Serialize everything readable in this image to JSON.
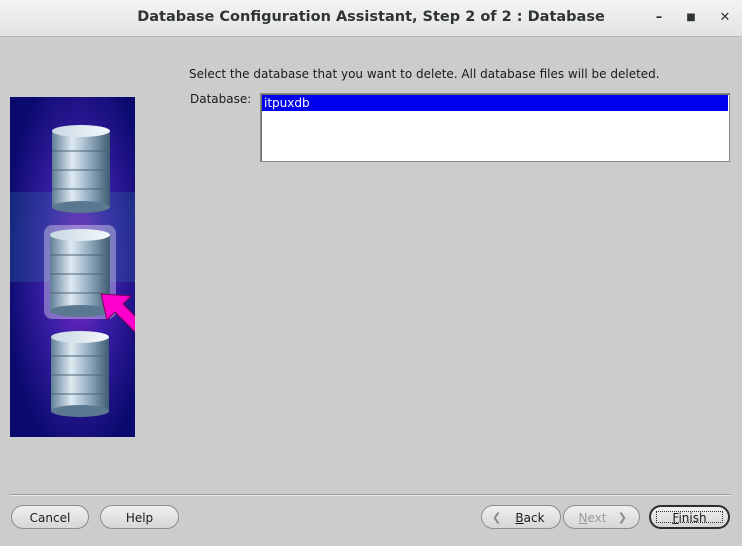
{
  "window": {
    "title": "Database Configuration Assistant, Step 2 of 2 : Database",
    "controls": {
      "minimize": "–",
      "maximize": "■",
      "close": "✕"
    }
  },
  "main": {
    "instruction": "Select the database that you want to delete. All database files will be deleted.",
    "database_label": "Database:",
    "databases": [
      "itpuxdb"
    ],
    "selected_index": 0
  },
  "buttons": {
    "cancel": "Cancel",
    "help": "Help",
    "back_first": "B",
    "back_rest": "ack",
    "next_first": "N",
    "next_rest": "ext",
    "finish_first": "F",
    "finish_rest": "inish"
  },
  "colors": {
    "selection": "#0000ee",
    "art_background": "#0a0a6e",
    "arrow": "#ff00cc"
  }
}
